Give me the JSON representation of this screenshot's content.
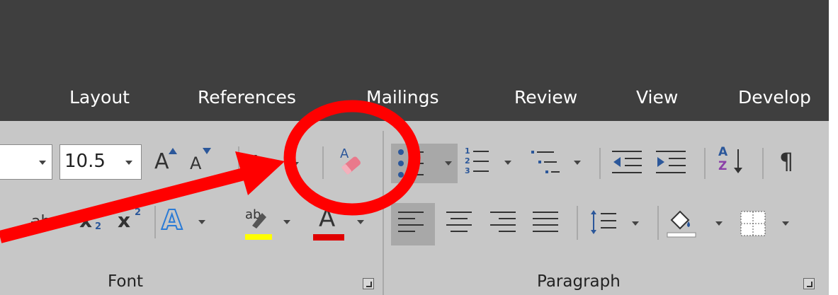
{
  "tabs": [
    {
      "label": "Layout"
    },
    {
      "label": "References"
    },
    {
      "label": "Mailings"
    },
    {
      "label": "Review"
    },
    {
      "label": "View"
    },
    {
      "label": "Develop"
    }
  ],
  "font_group": {
    "label": "Font",
    "font_size": "10.5",
    "strikethrough_glyph": "abc",
    "subscript_glyph": "x",
    "subscript_index": "2",
    "superscript_glyph": "x",
    "superscript_index": "2",
    "grow_glyph": "A",
    "shrink_glyph": "A",
    "change_case_glyph": "Aa",
    "text_effects_glyph": "A",
    "highlight_glyph": "ab",
    "font_color_glyph": "A",
    "highlight_color": "#ffff00",
    "font_color": "#e00000"
  },
  "paragraph_group": {
    "label": "Paragraph",
    "sort_glyph_top": "A",
    "sort_glyph_bottom": "Z",
    "pilcrow": "¶",
    "numbering_digits": [
      "1",
      "2",
      "3"
    ]
  },
  "annotation": {
    "color": "#ff0000"
  },
  "colors": {
    "ribbon_bg": "#c7c7c7",
    "tab_bar_bg": "#3f3f3f",
    "accent_blue": "#2b579a"
  }
}
